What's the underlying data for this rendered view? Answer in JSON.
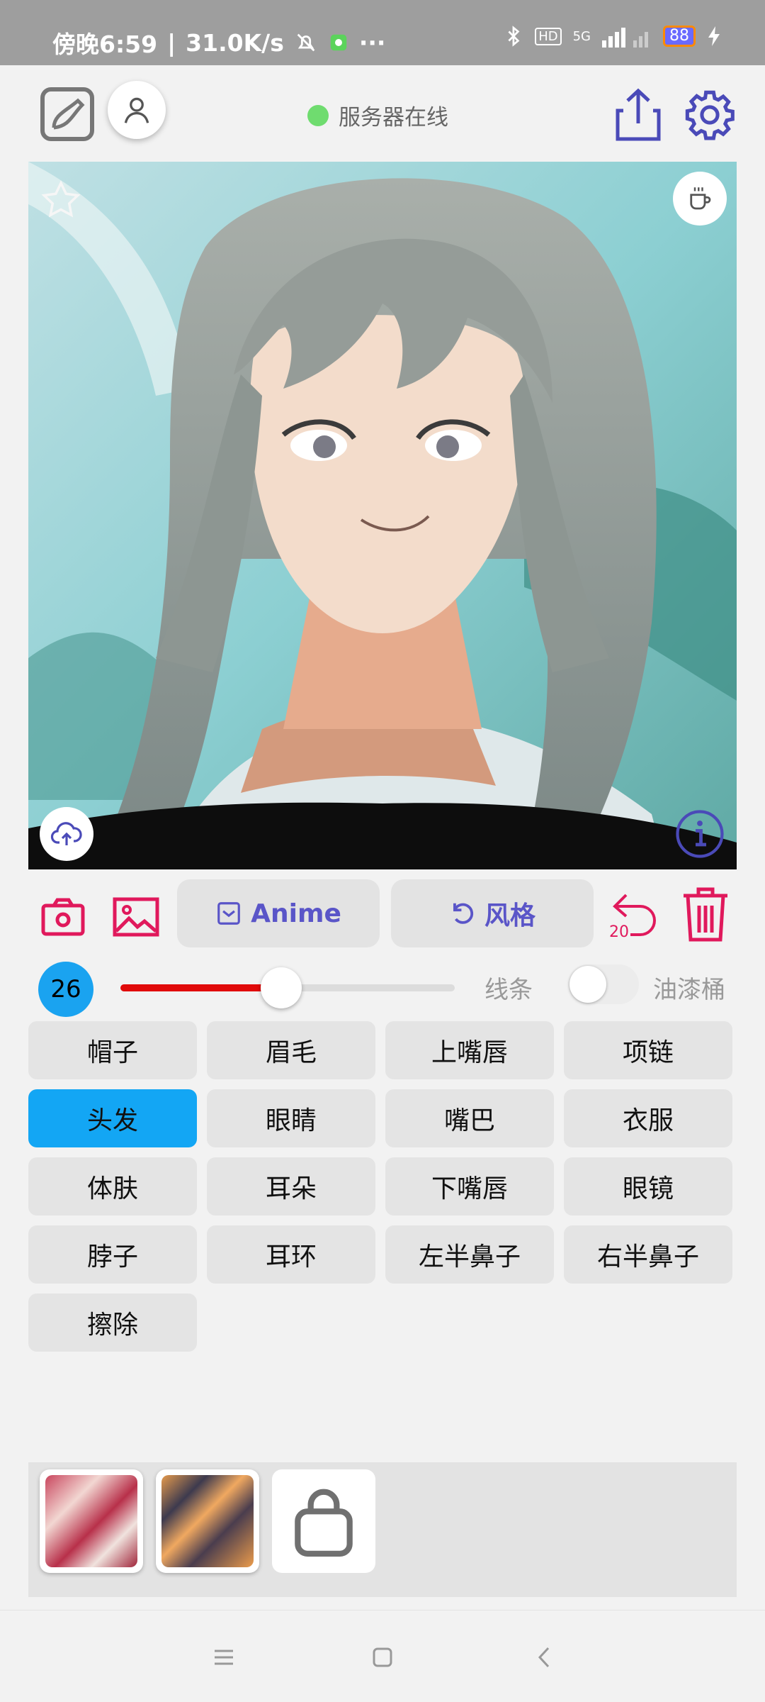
{
  "status_bar": {
    "time_label": "傍晚6:59",
    "network_speed": "31.0K/s",
    "network_type": "5G",
    "battery": "88",
    "icons": [
      "mute-icon",
      "vpn-icon",
      "more-icon",
      "bluetooth-icon",
      "hd-icon",
      "signal-icon",
      "charging-icon"
    ]
  },
  "header": {
    "server_status": "服务器在线",
    "status_color": "#6fdc6f",
    "icons": [
      "draw-edit-icon",
      "user-icon",
      "share-icon",
      "settings-icon"
    ]
  },
  "canvas": {
    "icons": [
      "star-icon",
      "coffee-icon",
      "upload-icon",
      "info-icon"
    ]
  },
  "toolbar": {
    "model_label": "Anime",
    "style_label": "风格",
    "undo_count": "20",
    "icons": [
      "camera-icon",
      "image-icon",
      "undo-icon",
      "trash-icon"
    ]
  },
  "brush": {
    "size": "26",
    "slider_fraction": 0.48,
    "line_label": "线条",
    "bucket_label": "油漆桶",
    "bucket_enabled": false
  },
  "parts": {
    "items": [
      "帽子",
      "眉毛",
      "上嘴唇",
      "项链",
      "头发",
      "眼睛",
      "嘴巴",
      "衣服",
      "体肤",
      "耳朵",
      "下嘴唇",
      "眼镜",
      "脖子",
      "耳环",
      "左半鼻子",
      "右半鼻子",
      "擦除"
    ],
    "selected": "头发",
    "accent": "#13a6f4"
  },
  "tray": {
    "icons": [
      "lock-icon"
    ]
  },
  "nav": {
    "icons": [
      "menu-icon",
      "home-icon",
      "back-icon"
    ]
  }
}
